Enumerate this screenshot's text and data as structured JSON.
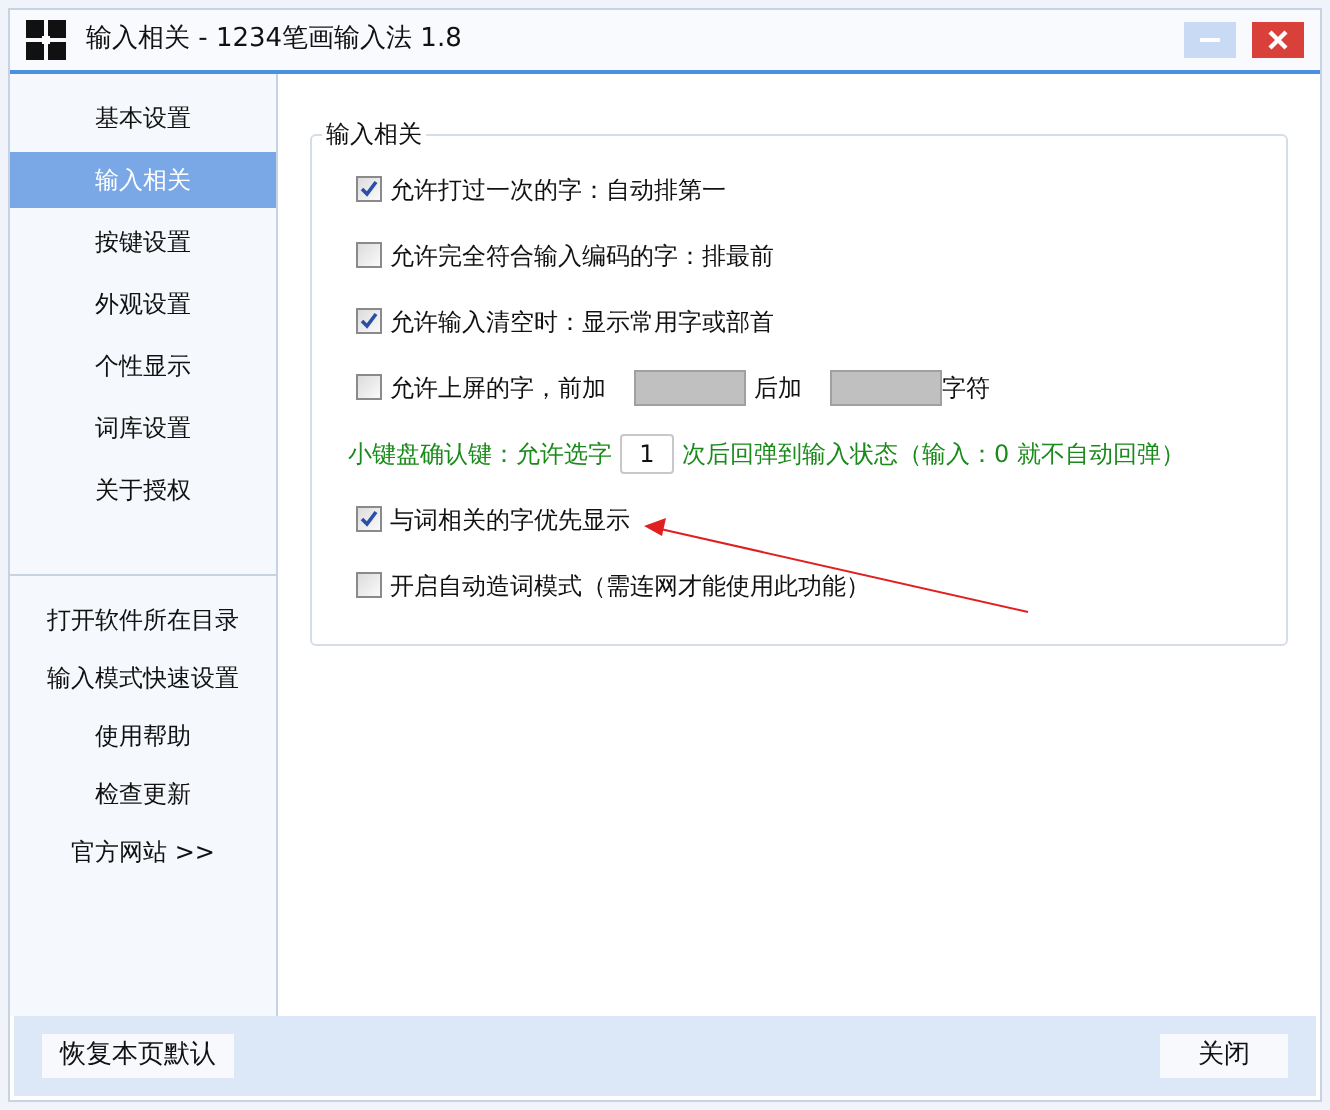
{
  "window": {
    "title": "输入相关 - 1234笔画输入法 1.8"
  },
  "sidebar": {
    "items": [
      {
        "label": "基本设置",
        "selected": false
      },
      {
        "label": "输入相关",
        "selected": true
      },
      {
        "label": "按键设置",
        "selected": false
      },
      {
        "label": "外观设置",
        "selected": false
      },
      {
        "label": "个性显示",
        "selected": false
      },
      {
        "label": "词库设置",
        "selected": false
      },
      {
        "label": "关于授权",
        "selected": false
      }
    ],
    "links": [
      "打开软件所在目录",
      "输入模式快速设置",
      "使用帮助",
      "检查更新",
      "官方网站 >>"
    ]
  },
  "group": {
    "title": "输入相关",
    "options": [
      {
        "kind": "checkbox",
        "label": "允许打过一次的字：自动排第一",
        "checked": true
      },
      {
        "kind": "checkbox",
        "label": "允许完全符合输入编码的字：排最前",
        "checked": false
      },
      {
        "kind": "checkbox",
        "label": "允许输入清空时：显示常用字或部首",
        "checked": true
      },
      {
        "kind": "affix",
        "label": "允许上屏的字，前加",
        "middle": "后加",
        "suffix": "字符",
        "checked": false,
        "disabled": true
      },
      {
        "kind": "count",
        "before": "小键盘确认键：允许选字",
        "value": "1",
        "after": "次后回弹到输入状态（输入：0 就不自动回弹）"
      },
      {
        "kind": "checkbox",
        "label": "与词相关的字优先显示",
        "checked": true
      },
      {
        "kind": "checkbox",
        "label": "开启自动造词模式（需连网才能使用此功能）",
        "checked": false
      }
    ]
  },
  "footer": {
    "buttons": [
      "恢复本页默认",
      "关闭"
    ]
  }
}
